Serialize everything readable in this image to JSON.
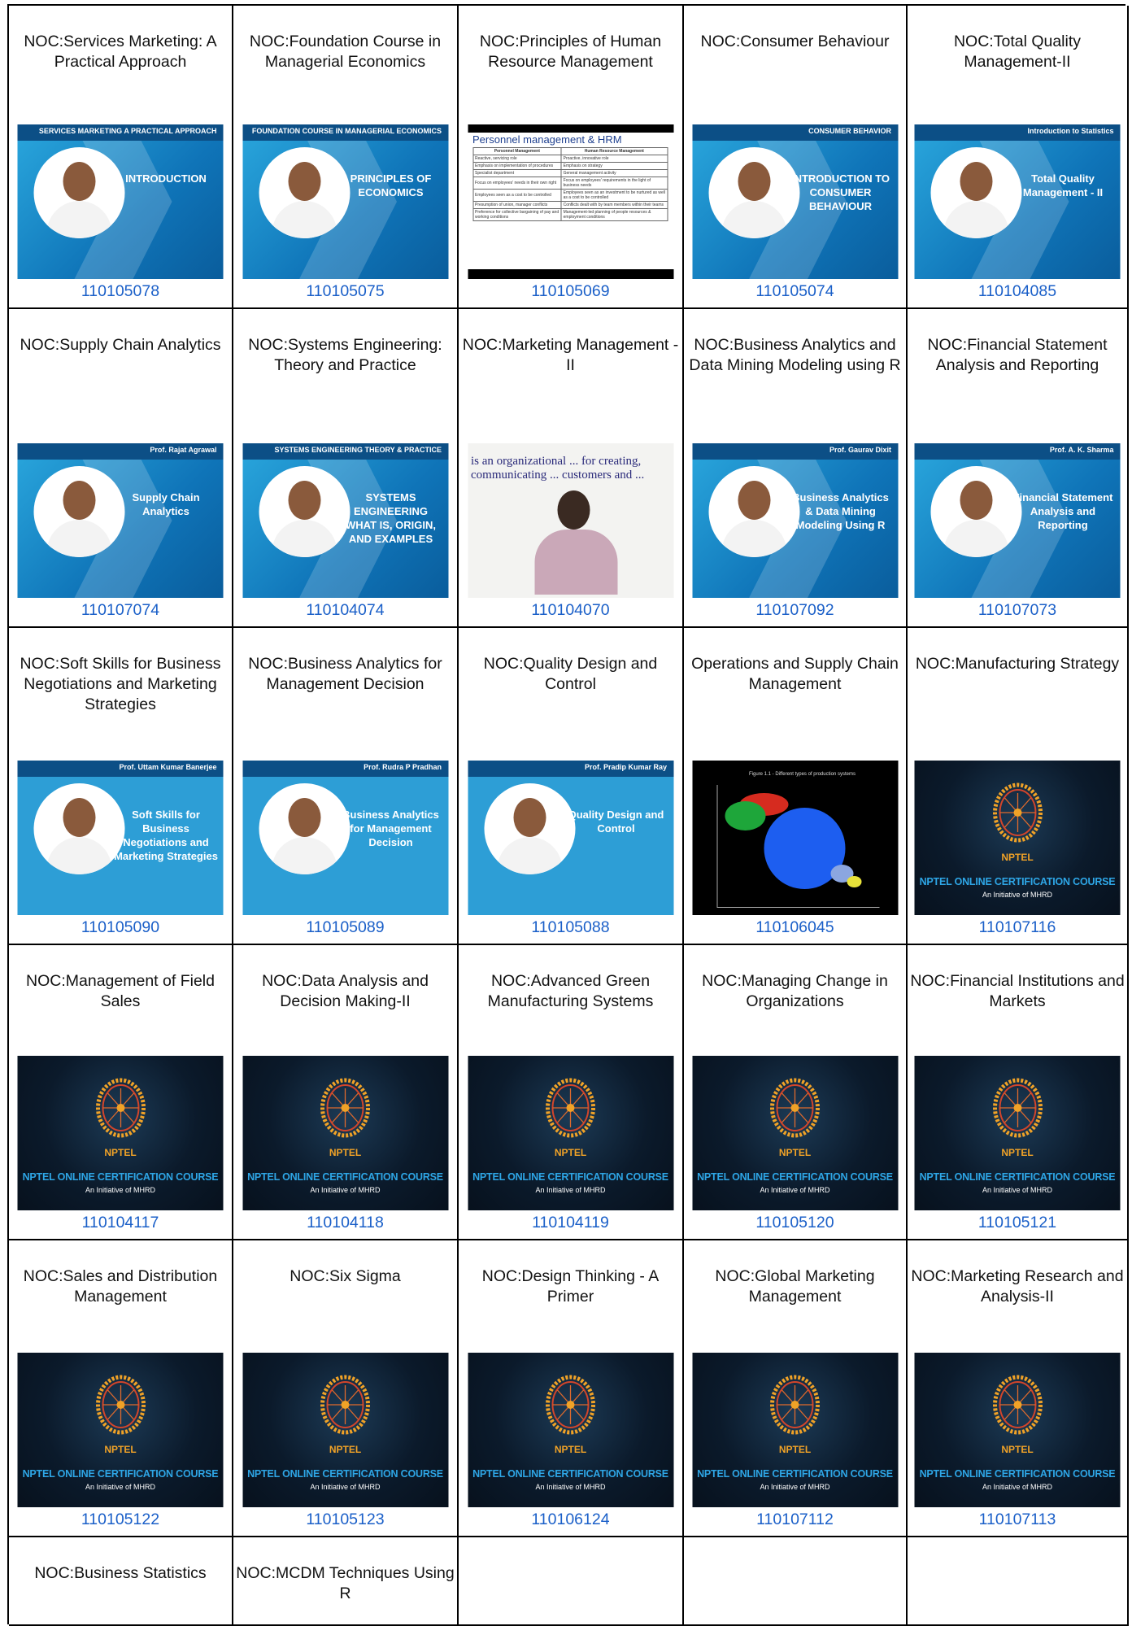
{
  "cells": [
    {
      "title": "NOC:Services Marketing: A Practical Approach",
      "code": "110105078",
      "thumb": "blue",
      "thumb_title": "INTRODUCTION",
      "thumb_header": "SERVICES MARKETING A PRACTICAL APPROACH"
    },
    {
      "title": "NOC:Foundation Course in Managerial Economics",
      "code": "110105075",
      "thumb": "blue",
      "thumb_title": "PRINCIPLES OF ECONOMICS",
      "thumb_header": "FOUNDATION COURSE IN MANAGERIAL ECONOMICS"
    },
    {
      "title": "NOC:Principles of Human Resource Management",
      "code": "110105069",
      "thumb": "hrm",
      "thumb_title": "Personnel management & HRM"
    },
    {
      "title": "NOC:Consumer Behaviour",
      "code": "110105074",
      "thumb": "blue",
      "thumb_title": "INTRODUCTION TO CONSUMER BEHAVIOUR",
      "thumb_header": "CONSUMER BEHAVIOR"
    },
    {
      "title": "NOC:Total Quality Management-II",
      "code": "110104085",
      "thumb": "blue",
      "thumb_title": "Total Quality Management - II",
      "thumb_header": "Introduction to Statistics"
    },
    {
      "title": "NOC:Supply Chain Analytics",
      "code": "110107074",
      "thumb": "blue",
      "thumb_title": "Supply Chain Analytics",
      "thumb_header": "Prof. Rajat Agrawal"
    },
    {
      "title": "NOC:Systems Engineering: Theory and Practice",
      "code": "110104074",
      "thumb": "blue",
      "thumb_title": "SYSTEMS ENGINEERING WHAT IS, ORIGIN, AND EXAMPLES",
      "thumb_header": "SYSTEMS ENGINEERING THEORY & PRACTICE"
    },
    {
      "title": "NOC:Marketing Management - II",
      "code": "110104070",
      "thumb": "lecture",
      "thumb_title": "is an organizational ... for creating, communicating ... customers and ..."
    },
    {
      "title": "NOC:Business Analytics and Data Mining Modeling using R",
      "code": "110107092",
      "thumb": "blue",
      "thumb_title": "Business Analytics & Data Mining Modeling Using R",
      "thumb_header": "Prof. Gaurav Dixit"
    },
    {
      "title": "NOC:Financial Statement Analysis and Reporting",
      "code": "110107073",
      "thumb": "blue",
      "thumb_title": "Financial Statement Analysis and Reporting",
      "thumb_header": "Prof. A. K. Sharma"
    },
    {
      "title": "NOC:Soft Skills for Business Negotiations and Marketing Strategies",
      "code": "110105090",
      "thumb": "light",
      "thumb_title": "Soft Skills for Business Negotiations and Marketing Strategies",
      "thumb_header": "Prof. Uttam Kumar Banerjee"
    },
    {
      "title": "NOC:Business Analytics for Management Decision",
      "code": "110105089",
      "thumb": "light",
      "thumb_title": "Business Analytics for Management Decision",
      "thumb_header": "Prof. Rudra P Pradhan"
    },
    {
      "title": "NOC:Quality Design and Control",
      "code": "110105088",
      "thumb": "light",
      "thumb_title": "Quality Design and Control",
      "thumb_header": "Prof. Pradip Kumar Ray"
    },
    {
      "title": "Operations and Supply Chain Management",
      "code": "110106045",
      "thumb": "chart",
      "thumb_title": "Figure 1.1 - Different types of production systems"
    },
    {
      "title": "NOC:Manufacturing Strategy",
      "code": "110107116",
      "thumb": "nptel"
    },
    {
      "title": "NOC:Management of Field Sales",
      "code": "110104117",
      "thumb": "nptel"
    },
    {
      "title": "NOC:Data Analysis and Decision Making-II",
      "code": "110104118",
      "thumb": "nptel"
    },
    {
      "title": "NOC:Advanced Green Manufacturing Systems",
      "code": "110104119",
      "thumb": "nptel"
    },
    {
      "title": "NOC:Managing Change in Organizations",
      "code": "110105120",
      "thumb": "nptel"
    },
    {
      "title": "NOC:Financial Institutions and Markets",
      "code": "110105121",
      "thumb": "nptel"
    },
    {
      "title": "NOC:Sales and Distribution Management",
      "code": "110105122",
      "thumb": "nptel"
    },
    {
      "title": "NOC:Six Sigma",
      "code": "110105123",
      "thumb": "nptel"
    },
    {
      "title": "NOC:Design Thinking - A Primer",
      "code": "110106124",
      "thumb": "nptel"
    },
    {
      "title": "NOC:Global Marketing Management",
      "code": "110107112",
      "thumb": "nptel"
    },
    {
      "title": "NOC:Marketing Research and Analysis-II",
      "code": "110107113",
      "thumb": "nptel"
    },
    {
      "title": "NOC:Business Statistics",
      "code": "",
      "thumb": "none"
    },
    {
      "title": "NOC:MCDM Techniques Using R",
      "code": "",
      "thumb": "none"
    },
    {
      "title": "",
      "code": "",
      "thumb": "none"
    },
    {
      "title": "",
      "code": "",
      "thumb": "none"
    },
    {
      "title": "",
      "code": "",
      "thumb": "none"
    }
  ],
  "nptel": {
    "label": "NPTEL",
    "course": "NPTEL ONLINE CERTIFICATION COURSE",
    "initiative": "An Initiative of MHRD"
  },
  "hrm_table": {
    "headers": [
      "Personnel Management",
      "Human Resource Management"
    ],
    "rows": [
      [
        "Reactive, servicing role",
        "Proactive, innovative role"
      ],
      [
        "Emphasis on implementation of procedures",
        "Emphasis on strategy"
      ],
      [
        "Specialist department",
        "General management activity"
      ],
      [
        "Focus on employees' needs in their own right",
        "Focus on employees' requirements in the light of business needs"
      ],
      [
        "Employees seen as a cost to be controlled",
        "Employees seen as an investment to be nurtured as well as a cost to be controlled"
      ],
      [
        "Presumption of union, manager conflicts",
        "Conflicts dealt with by team members within their teams"
      ],
      [
        "Preference for collective bargaining of pay and working conditions",
        "Management-led planning of people resources & employment conditions"
      ]
    ]
  },
  "colors": {
    "link": "#1a5fc8",
    "nptel_orange": "#f0a227",
    "nptel_blue": "#2ea6e6"
  }
}
